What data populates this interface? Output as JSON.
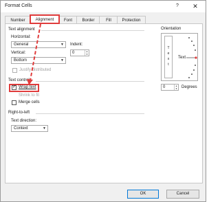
{
  "window": {
    "title": "Format Cells",
    "help_label": "?",
    "close_label": "✕"
  },
  "tabs": [
    {
      "label": "Number"
    },
    {
      "label": "Alignment"
    },
    {
      "label": "Font"
    },
    {
      "label": "Border"
    },
    {
      "label": "Fill"
    },
    {
      "label": "Protection"
    }
  ],
  "text_alignment": {
    "title": "Text alignment",
    "horizontal_label": "Horizontal:",
    "horizontal_value": "General",
    "vertical_label": "Vertical:",
    "vertical_value": "Bottom",
    "indent_label": "Indent:",
    "indent_value": "0",
    "justify_distributed": "Justify distributed"
  },
  "text_control": {
    "title": "Text control",
    "wrap_text": "Wrap text",
    "wrap_checked": true,
    "shrink_to_fit": "Shrink to fit",
    "merge_cells": "Merge cells"
  },
  "right_to_left": {
    "title": "Right-to-left",
    "direction_label": "Text direction:",
    "direction_value": "Context"
  },
  "orientation": {
    "title": "Orientation",
    "vertical_letters": [
      "T",
      "e",
      "x",
      "t"
    ],
    "rotated_label": "Text",
    "degrees_value": "0",
    "degrees_label": "Degrees"
  },
  "buttons": {
    "ok": "OK",
    "cancel": "Cancel"
  },
  "colors": {
    "highlight": "#e03c3c",
    "orient_marker": "#e03c3c"
  },
  "icons": {
    "dropdown": "chevron-down-icon",
    "check": "checkmark-icon",
    "help": "help-icon",
    "close": "close-icon"
  }
}
